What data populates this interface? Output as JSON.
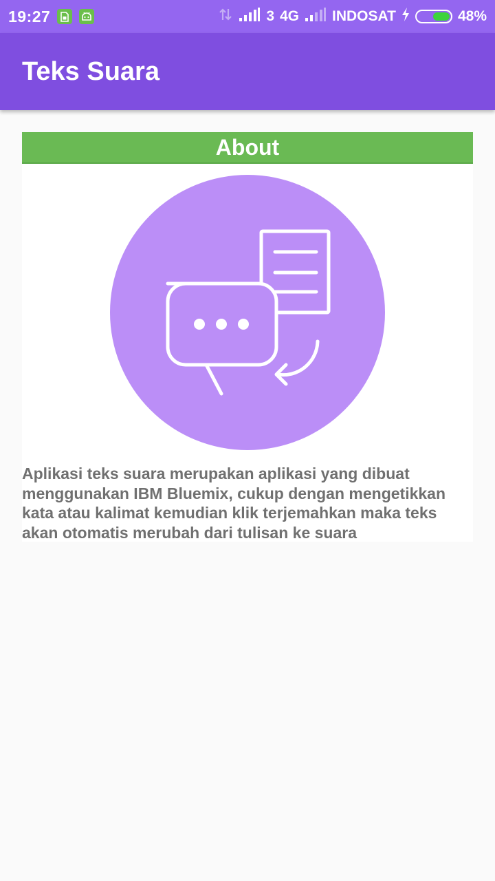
{
  "status_bar": {
    "time": "19:27",
    "sim_number": "3",
    "network_type": "4G",
    "carrier": "INDOSAT",
    "battery_percent": "48%",
    "battery_level": 0.48,
    "icons": [
      "sim-card-icon",
      "android-icon",
      "data-transfer-icon",
      "signal-icon",
      "signal-icon",
      "charging-icon",
      "battery-icon"
    ]
  },
  "app_bar": {
    "title": "Teks Suara"
  },
  "card": {
    "title": "About",
    "illustration": {
      "icon": "speech-to-document-icon",
      "circle_color": "#bb8ef7"
    },
    "description": "Aplikasi teks suara merupakan aplikasi yang dibuat menggunakan IBM Bluemix, cukup dengan mengetikkan kata atau kalimat kemudian klik terjemahkan maka teks akan otomatis merubah dari tulisan ke suara"
  },
  "colors": {
    "status_bar": "#9466f0",
    "app_bar": "#7f4ee0",
    "card_header": "#6aba54",
    "description_text": "#707070",
    "background": "#fafafa"
  }
}
